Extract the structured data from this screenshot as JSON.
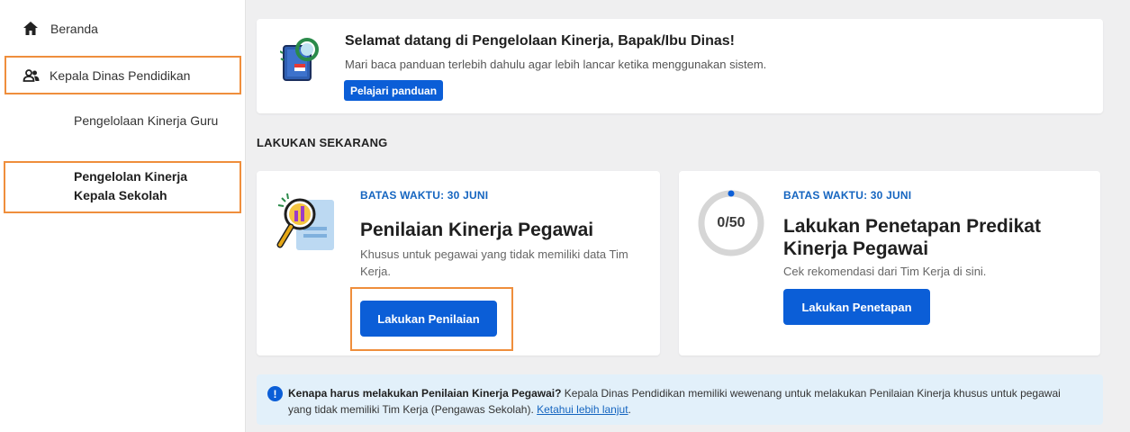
{
  "sidebar": {
    "home_label": "Beranda",
    "role_label": "Kepala Dinas Pendidikan",
    "sub_items": [
      {
        "label": "Pengelolaan Kinerja Guru"
      },
      {
        "label": "Pengelolan Kinerja Kepala Sekolah"
      }
    ]
  },
  "banner": {
    "title": "Selamat datang di Pengelolaan Kinerja, Bapak/Ibu Dinas!",
    "subtitle": "Mari baca panduan terlebih dahulu agar lebih lancar ketika menggunakan sistem.",
    "button_label": "Pelajari panduan"
  },
  "section_title": "LAKUKAN SEKARANG",
  "cards": [
    {
      "deadline": "BATAS WAKTU: 30 JUNI",
      "title": "Penilaian Kinerja Pegawai",
      "desc": "Khusus untuk pegawai yang tidak memiliki data Tim Kerja.",
      "button_label": "Lakukan Penilaian"
    },
    {
      "deadline": "BATAS WAKTU: 30 JUNI",
      "title": "Lakukan Penetapan Predikat Kinerja Pegawai",
      "desc": "Cek rekomendasi dari Tim Kerja di sini.",
      "button_label": "Lakukan Penetapan",
      "progress_text": "0/50",
      "progress_fraction": 0
    }
  ],
  "info": {
    "icon": "!",
    "bold": "Kenapa harus melakukan Penilaian Kinerja Pegawai?",
    "text": " Kepala Dinas Pendidikan memiliki wewenang untuk melakukan Penilaian Kinerja khusus untuk pegawai yang tidak memiliki Tim Kerja (Pengawas Sekolah). ",
    "link": "Ketahui lebih lanjut",
    "end": "."
  },
  "colors": {
    "accent": "#0b5ed7",
    "highlight_border": "#ef8e3c",
    "deadline": "#1565c0",
    "info_bg": "#e2f0fa"
  }
}
